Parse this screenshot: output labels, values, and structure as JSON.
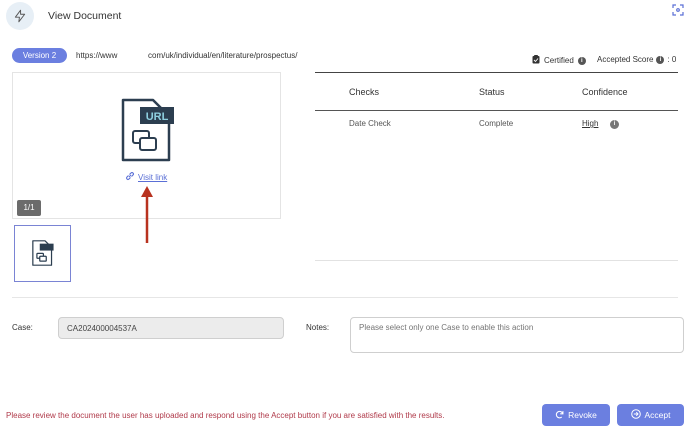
{
  "header": {
    "title": "View Document",
    "icon": "lightning-bolt-icon"
  },
  "document": {
    "version_label": "Version 2",
    "url_start": "https://www",
    "url_end": "com/uk/individual/en/literature/prospectus/",
    "certified_label": "Certified",
    "accepted_score_label": "Accepted Score",
    "accepted_score_value": ": 0",
    "visit_link_label": "Visit link",
    "page_indicator": "1/1",
    "file_type_label": "URL"
  },
  "checks": {
    "headers": [
      "Checks",
      "Status",
      "Confidence"
    ],
    "rows": [
      {
        "check": "Date Check",
        "status": "Complete",
        "confidence": "High"
      }
    ]
  },
  "form": {
    "case_label": "Case:",
    "case_value": "CA202400004537A",
    "notes_label": "Notes:",
    "notes_placeholder": "Please select only one Case to enable this action"
  },
  "footer": {
    "message": "Please review the document the user has uploaded and respond using the Accept button if you are satisfied with the results.",
    "revoke_label": "Revoke",
    "accept_label": "Accept"
  },
  "colors": {
    "accent": "#6b7fe0",
    "message": "#b03a4a",
    "arrow": "#b8321f"
  }
}
